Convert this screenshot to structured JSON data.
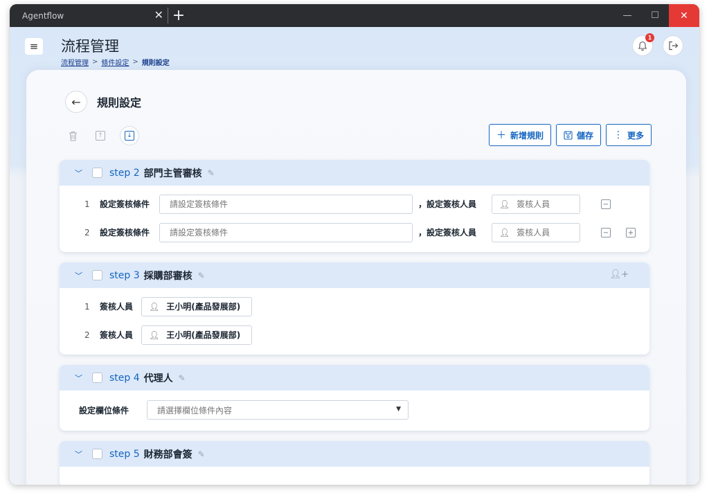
{
  "titlebar": {
    "tab_title": "Agentflow",
    "tab_close": "✕",
    "new_tab": "+",
    "minimize": "—",
    "maximize": "☐",
    "close": "✕"
  },
  "header": {
    "menu_icon": "≡",
    "title": "流程管理",
    "breadcrumb": [
      "流程管理",
      "條件設定",
      "規則設定"
    ],
    "breadcrumb_sep": ">",
    "notification_count": "1"
  },
  "page": {
    "back_icon": "←",
    "section_title": "規則設定",
    "actions": {
      "add_rule": "新增規則",
      "save": "儲存",
      "more": "更多"
    }
  },
  "steps": [
    {
      "label": "step 2",
      "name": "部門主管審核",
      "rows": [
        {
          "num": "1",
          "cond_label": "設定簽核條件",
          "cond_placeholder": "請設定簽核條件",
          "person_label": "，設定簽核人員",
          "person_placeholder": "簽核人員"
        },
        {
          "num": "2",
          "cond_label": "設定簽核條件",
          "cond_placeholder": "請設定簽核條件",
          "person_label": "，設定簽核人員",
          "person_placeholder": "簽核人員"
        }
      ]
    },
    {
      "label": "step 3",
      "name": "採購部審核",
      "rows": [
        {
          "num": "1",
          "approver_label": "簽核人員",
          "approver": "王小明(產品發展部)"
        },
        {
          "num": "2",
          "approver_label": "簽核人員",
          "approver": "王小明(產品發展部)"
        }
      ]
    },
    {
      "label": "step 4",
      "name": "代理人",
      "field_label": "設定欄位條件",
      "field_placeholder": "請選擇欄位條件內容"
    },
    {
      "label": "step 5",
      "name": "財務部會簽"
    }
  ],
  "colors": {
    "accent": "#1565c0",
    "step_header": "#dde9f9",
    "titlebar": "#2b2d31",
    "close_red": "#e53935"
  }
}
